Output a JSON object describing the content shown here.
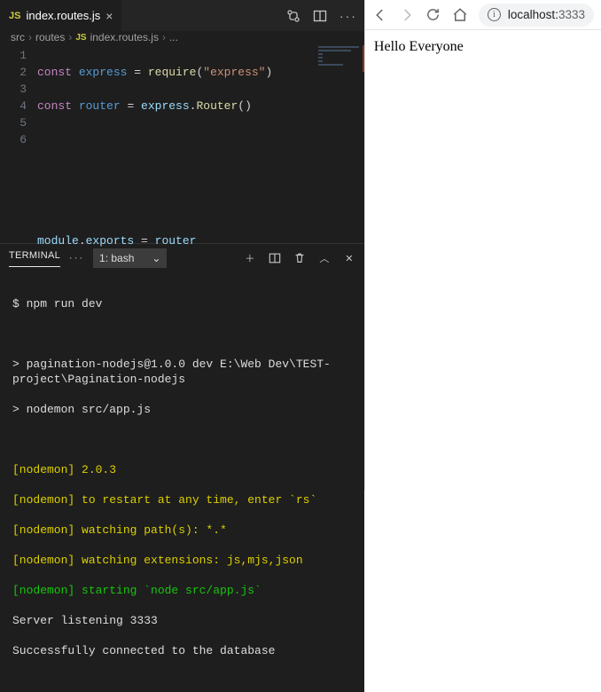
{
  "editor": {
    "tab": {
      "icon_label": "JS",
      "filename": "index.routes.js"
    },
    "breadcrumbs": [
      "src",
      "routes",
      "index.routes.js",
      "..."
    ],
    "breadcrumb_icon_label": "JS",
    "lines": [
      "1",
      "2",
      "3",
      "4",
      "5",
      "6"
    ],
    "code": {
      "l1": {
        "kw": "const",
        "id": "express",
        "eq": " = ",
        "fn": "require",
        "open": "(",
        "str": "\"express\"",
        "close": ")"
      },
      "l2": {
        "kw": "const",
        "id": "router",
        "eq": " = ",
        "obj": "express",
        "dot": ".",
        "fn": "Router",
        "par": "()"
      },
      "l6": {
        "obj": "module",
        "dot1": ".",
        "prop": "exports",
        "eq": " = ",
        "val": "router"
      }
    }
  },
  "terminal": {
    "tab_label": "TERMINAL",
    "shell_label": "1: bash",
    "lines": {
      "cmd1": "$ npm run dev",
      "run1": "> pagination-nodejs@1.0.0 dev E:\\Web Dev\\TEST-project\\Pagination-nodejs",
      "run2": "> nodemon src/app.js",
      "n1": "[nodemon] 2.0.3",
      "n2": "[nodemon] to restart at any time, enter `rs`",
      "n3": "[nodemon] watching path(s): *.*",
      "n4": "[nodemon] watching extensions: js,mjs,json",
      "n5": "[nodemon] starting `node src/app.js`",
      "s1": "Server listening 3333",
      "s2": "Successfully connected to the database"
    }
  },
  "browser": {
    "url_host": "localhost:",
    "url_port": "3333",
    "page_text": "Hello Everyone"
  }
}
